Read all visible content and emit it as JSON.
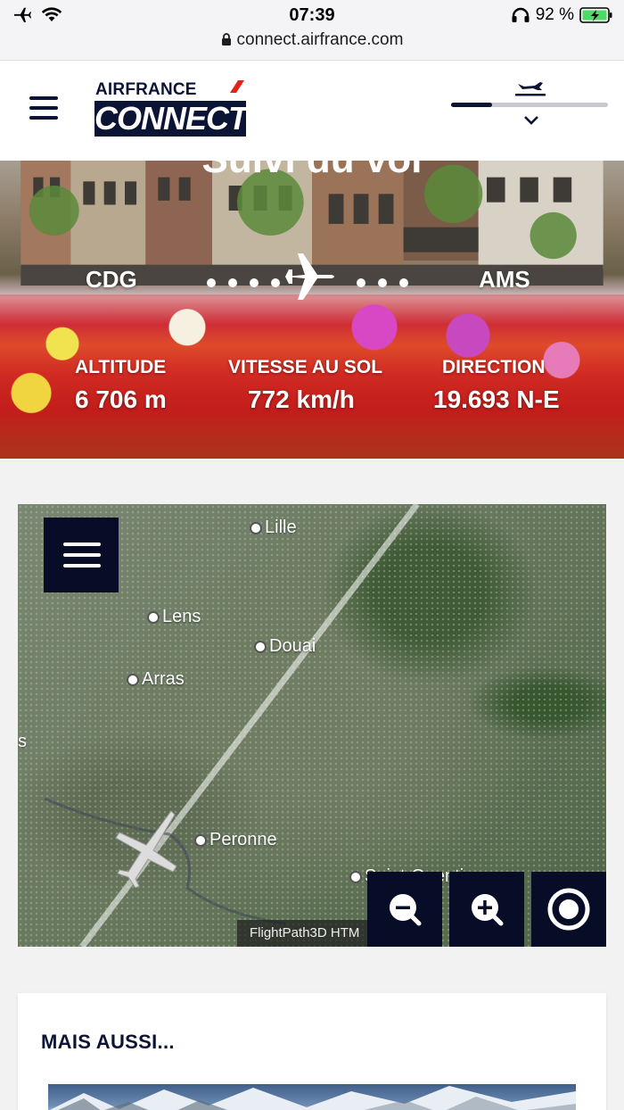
{
  "status_bar": {
    "time": "07:39",
    "battery": "92 %",
    "url": "connect.airfrance.com"
  },
  "header": {
    "logo_top": "AIRFRANCE",
    "logo_main": "CONNECT",
    "flight_progress": 0.26
  },
  "hero": {
    "title": "Suivi du vol",
    "origin": "CDG",
    "destination": "AMS",
    "stats": [
      {
        "label": "ALTITUDE",
        "value": "6 706 m"
      },
      {
        "label": "VITESSE AU SOL",
        "value": "772 km/h"
      },
      {
        "label": "DIRECTION",
        "value": "19.693 N-E"
      }
    ]
  },
  "map": {
    "cities": [
      {
        "name": "Lille"
      },
      {
        "name": "Lens"
      },
      {
        "name": "Douai"
      },
      {
        "name": "Arras"
      },
      {
        "name": "Peronne"
      },
      {
        "name": "Saint-Quentin"
      }
    ],
    "edge_label": "s",
    "credit": "FlightPath3D HTM"
  },
  "section": {
    "title": "MAIS AUSSI..."
  },
  "colors": {
    "brand_navy": "#0b1434",
    "brand_red": "#e2231a"
  }
}
